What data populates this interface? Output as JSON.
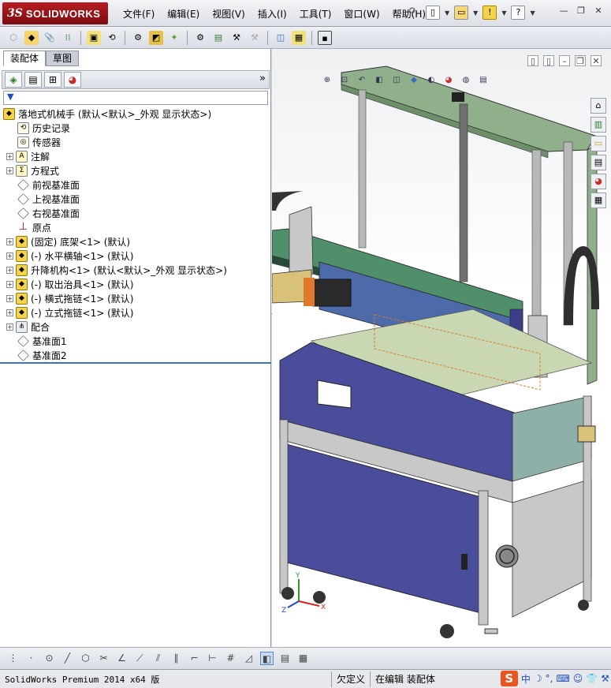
{
  "app": {
    "logo_ds": "3S",
    "logo_text": "SOLIDWORKS"
  },
  "menu": [
    "文件(F)",
    "编辑(E)",
    "视图(V)",
    "插入(I)",
    "工具(T)",
    "窗口(W)",
    "帮助(H)"
  ],
  "left_tabs": [
    "装配体",
    "草图"
  ],
  "feature_tree": {
    "root": "落地式机械手  (默认<默认>_外观 显示状态>)",
    "items": [
      {
        "label": "历史记录",
        "icon": "history-icon",
        "expandable": false
      },
      {
        "label": "传感器",
        "icon": "sensor-icon",
        "expandable": false
      },
      {
        "label": "注解",
        "icon": "annotation-icon",
        "expandable": true
      },
      {
        "label": "方程式",
        "icon": "equation-icon",
        "expandable": true
      },
      {
        "label": "前视基准面",
        "icon": "plane-icon",
        "expandable": false
      },
      {
        "label": "上视基准面",
        "icon": "plane-icon",
        "expandable": false
      },
      {
        "label": "右视基准面",
        "icon": "plane-icon",
        "expandable": false
      },
      {
        "label": "原点",
        "icon": "origin-icon",
        "expandable": false
      },
      {
        "label": "(固定) 底架<1> (默认)",
        "icon": "subassembly-icon",
        "expandable": true
      },
      {
        "label": "(-) 水平横轴<1> (默认)",
        "icon": "subassembly-icon",
        "expandable": true
      },
      {
        "label": "升降机构<1> (默认<默认>_外观 显示状态>)",
        "icon": "subassembly-icon",
        "expandable": true
      },
      {
        "label": "(-) 取出治具<1> (默认)",
        "icon": "subassembly-icon",
        "expandable": true
      },
      {
        "label": "(-) 横式拖链<1> (默认)",
        "icon": "subassembly-icon",
        "expandable": true
      },
      {
        "label": "(-) 立式拖链<1> (默认)",
        "icon": "subassembly-icon",
        "expandable": true
      },
      {
        "label": "配合",
        "icon": "mate-icon",
        "expandable": true
      },
      {
        "label": "基准面1",
        "icon": "plane-icon",
        "expandable": false
      },
      {
        "label": "基准面2",
        "icon": "plane-icon",
        "expandable": false
      }
    ]
  },
  "triad": {
    "x": "X",
    "y": "Y",
    "z": "Z"
  },
  "status": {
    "product": "SolidWorks Premium 2014 x64 版",
    "state": "欠定义",
    "mode": "在编辑 装配体"
  },
  "ime": {
    "logo": "S",
    "lang": "中"
  },
  "colors": {
    "frame_blue": "#4a4d9c",
    "frame_grey": "#c8c8c8",
    "panel_green": "#8fb08a",
    "rail_green": "#4f8f6a",
    "accent_orange": "#e07a2a"
  }
}
